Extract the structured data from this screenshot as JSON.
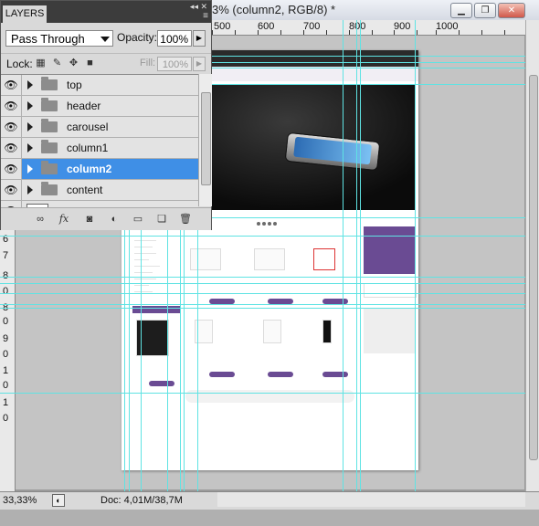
{
  "window": {
    "document_title": "3% (column2, RGB/8) *",
    "minimize_label": "▁",
    "restore_label": "❐",
    "close_label": "✕"
  },
  "ruler_top": [
    "500",
    "600",
    "700",
    "800",
    "900",
    "1000"
  ],
  "ruler_left": [
    "6",
    "7",
    "8",
    "0",
    "8",
    "0",
    "9",
    "0",
    "1",
    "0",
    "1",
    "0"
  ],
  "layers_panel": {
    "tab_label": "LAYERS",
    "blend_mode": "Pass Through",
    "opacity_label": "Opacity:",
    "opacity_value": "100%",
    "lock_label": "Lock:",
    "fill_label": "Fill:",
    "fill_value": "100%",
    "layers": [
      {
        "name": "top",
        "selected": false
      },
      {
        "name": "header",
        "selected": false
      },
      {
        "name": "carousel",
        "selected": false
      },
      {
        "name": "column1",
        "selected": false
      },
      {
        "name": "column2",
        "selected": true
      },
      {
        "name": "content",
        "selected": false
      }
    ],
    "footer_icons": [
      "link-icon",
      "fx-icon",
      "mask-icon",
      "adjustment-icon",
      "folder-icon",
      "new-layer-icon",
      "trash-icon"
    ],
    "fx_label": "fx"
  },
  "status": {
    "zoom": "33,33%",
    "doc_info": "Doc: 4,01M/38,7M"
  },
  "colors": {
    "guide": "#5fe3e3",
    "selection": "#3f8fe6",
    "accent_purple": "#6a4b93"
  }
}
